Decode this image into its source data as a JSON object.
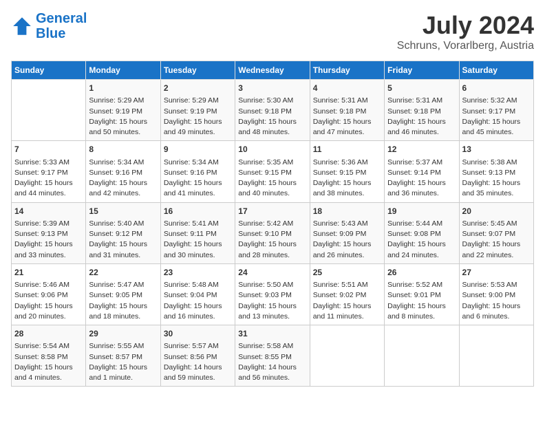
{
  "header": {
    "logo_line1": "General",
    "logo_line2": "Blue",
    "month": "July 2024",
    "location": "Schruns, Vorarlberg, Austria"
  },
  "weekdays": [
    "Sunday",
    "Monday",
    "Tuesday",
    "Wednesday",
    "Thursday",
    "Friday",
    "Saturday"
  ],
  "weeks": [
    [
      {
        "day": "",
        "info": ""
      },
      {
        "day": "1",
        "info": "Sunrise: 5:29 AM\nSunset: 9:19 PM\nDaylight: 15 hours\nand 50 minutes."
      },
      {
        "day": "2",
        "info": "Sunrise: 5:29 AM\nSunset: 9:19 PM\nDaylight: 15 hours\nand 49 minutes."
      },
      {
        "day": "3",
        "info": "Sunrise: 5:30 AM\nSunset: 9:18 PM\nDaylight: 15 hours\nand 48 minutes."
      },
      {
        "day": "4",
        "info": "Sunrise: 5:31 AM\nSunset: 9:18 PM\nDaylight: 15 hours\nand 47 minutes."
      },
      {
        "day": "5",
        "info": "Sunrise: 5:31 AM\nSunset: 9:18 PM\nDaylight: 15 hours\nand 46 minutes."
      },
      {
        "day": "6",
        "info": "Sunrise: 5:32 AM\nSunset: 9:17 PM\nDaylight: 15 hours\nand 45 minutes."
      }
    ],
    [
      {
        "day": "7",
        "info": "Sunrise: 5:33 AM\nSunset: 9:17 PM\nDaylight: 15 hours\nand 44 minutes."
      },
      {
        "day": "8",
        "info": "Sunrise: 5:34 AM\nSunset: 9:16 PM\nDaylight: 15 hours\nand 42 minutes."
      },
      {
        "day": "9",
        "info": "Sunrise: 5:34 AM\nSunset: 9:16 PM\nDaylight: 15 hours\nand 41 minutes."
      },
      {
        "day": "10",
        "info": "Sunrise: 5:35 AM\nSunset: 9:15 PM\nDaylight: 15 hours\nand 40 minutes."
      },
      {
        "day": "11",
        "info": "Sunrise: 5:36 AM\nSunset: 9:15 PM\nDaylight: 15 hours\nand 38 minutes."
      },
      {
        "day": "12",
        "info": "Sunrise: 5:37 AM\nSunset: 9:14 PM\nDaylight: 15 hours\nand 36 minutes."
      },
      {
        "day": "13",
        "info": "Sunrise: 5:38 AM\nSunset: 9:13 PM\nDaylight: 15 hours\nand 35 minutes."
      }
    ],
    [
      {
        "day": "14",
        "info": "Sunrise: 5:39 AM\nSunset: 9:13 PM\nDaylight: 15 hours\nand 33 minutes."
      },
      {
        "day": "15",
        "info": "Sunrise: 5:40 AM\nSunset: 9:12 PM\nDaylight: 15 hours\nand 31 minutes."
      },
      {
        "day": "16",
        "info": "Sunrise: 5:41 AM\nSunset: 9:11 PM\nDaylight: 15 hours\nand 30 minutes."
      },
      {
        "day": "17",
        "info": "Sunrise: 5:42 AM\nSunset: 9:10 PM\nDaylight: 15 hours\nand 28 minutes."
      },
      {
        "day": "18",
        "info": "Sunrise: 5:43 AM\nSunset: 9:09 PM\nDaylight: 15 hours\nand 26 minutes."
      },
      {
        "day": "19",
        "info": "Sunrise: 5:44 AM\nSunset: 9:08 PM\nDaylight: 15 hours\nand 24 minutes."
      },
      {
        "day": "20",
        "info": "Sunrise: 5:45 AM\nSunset: 9:07 PM\nDaylight: 15 hours\nand 22 minutes."
      }
    ],
    [
      {
        "day": "21",
        "info": "Sunrise: 5:46 AM\nSunset: 9:06 PM\nDaylight: 15 hours\nand 20 minutes."
      },
      {
        "day": "22",
        "info": "Sunrise: 5:47 AM\nSunset: 9:05 PM\nDaylight: 15 hours\nand 18 minutes."
      },
      {
        "day": "23",
        "info": "Sunrise: 5:48 AM\nSunset: 9:04 PM\nDaylight: 15 hours\nand 16 minutes."
      },
      {
        "day": "24",
        "info": "Sunrise: 5:50 AM\nSunset: 9:03 PM\nDaylight: 15 hours\nand 13 minutes."
      },
      {
        "day": "25",
        "info": "Sunrise: 5:51 AM\nSunset: 9:02 PM\nDaylight: 15 hours\nand 11 minutes."
      },
      {
        "day": "26",
        "info": "Sunrise: 5:52 AM\nSunset: 9:01 PM\nDaylight: 15 hours\nand 8 minutes."
      },
      {
        "day": "27",
        "info": "Sunrise: 5:53 AM\nSunset: 9:00 PM\nDaylight: 15 hours\nand 6 minutes."
      }
    ],
    [
      {
        "day": "28",
        "info": "Sunrise: 5:54 AM\nSunset: 8:58 PM\nDaylight: 15 hours\nand 4 minutes."
      },
      {
        "day": "29",
        "info": "Sunrise: 5:55 AM\nSunset: 8:57 PM\nDaylight: 15 hours\nand 1 minute."
      },
      {
        "day": "30",
        "info": "Sunrise: 5:57 AM\nSunset: 8:56 PM\nDaylight: 14 hours\nand 59 minutes."
      },
      {
        "day": "31",
        "info": "Sunrise: 5:58 AM\nSunset: 8:55 PM\nDaylight: 14 hours\nand 56 minutes."
      },
      {
        "day": "",
        "info": ""
      },
      {
        "day": "",
        "info": ""
      },
      {
        "day": "",
        "info": ""
      }
    ]
  ]
}
